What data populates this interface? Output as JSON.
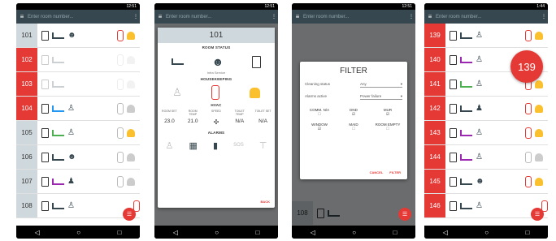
{
  "phone1": {
    "status_time": "12:51",
    "search_placeholder": "Enter room number...",
    "rows": [
      {
        "room": "101",
        "red": false
      },
      {
        "room": "102",
        "red": true
      },
      {
        "room": "103",
        "red": true
      },
      {
        "room": "104",
        "red": true
      },
      {
        "room": "105",
        "red": false
      },
      {
        "room": "106",
        "red": false
      },
      {
        "room": "107",
        "red": false
      },
      {
        "room": "108",
        "red": false
      }
    ]
  },
  "phone2": {
    "status_time": "12:51",
    "search_placeholder": "Enter room number...",
    "dialog": {
      "room": "101",
      "room_status": "ROOM STATUS",
      "service_label": "Infra Service",
      "housekeeping": "HOUSEKEEPING",
      "hvac": "HVAC",
      "hvac_labels": [
        "ROOM SET",
        "ROOM TEMP",
        "SPEED",
        "TOILET TEMP",
        "TOILET SET"
      ],
      "hvac_values": [
        "23.0",
        "21.0",
        "",
        "N/A",
        "N/A"
      ],
      "alarms": "ALARMS",
      "sos": "SOS",
      "back": "BACK"
    }
  },
  "phone3": {
    "status_time": "12:51",
    "search_placeholder": "Enter room number...",
    "filter": {
      "title": "FILTER",
      "cleaning_label": "Cleaning status",
      "cleaning_value": "Any",
      "alarms_label": "Alarms active",
      "alarms_value": "Power failure",
      "checks": [
        {
          "label": "COMM. N/A",
          "checked": false
        },
        {
          "label": "DND",
          "checked": true
        },
        {
          "label": "MUR",
          "checked": true
        },
        {
          "label": "WINDOW",
          "checked": true
        },
        {
          "label": "MAID",
          "checked": false
        },
        {
          "label": "ROOM EMPTY",
          "checked": false
        }
      ],
      "cancel": "CANCEL",
      "filter_btn": "FILTER"
    },
    "bg_room": "108"
  },
  "phone4": {
    "status_time": "1:44",
    "search_placeholder": "Enter room number...",
    "bubble": "139",
    "rows": [
      "139",
      "140",
      "141",
      "142",
      "143",
      "144",
      "145",
      "146"
    ]
  }
}
